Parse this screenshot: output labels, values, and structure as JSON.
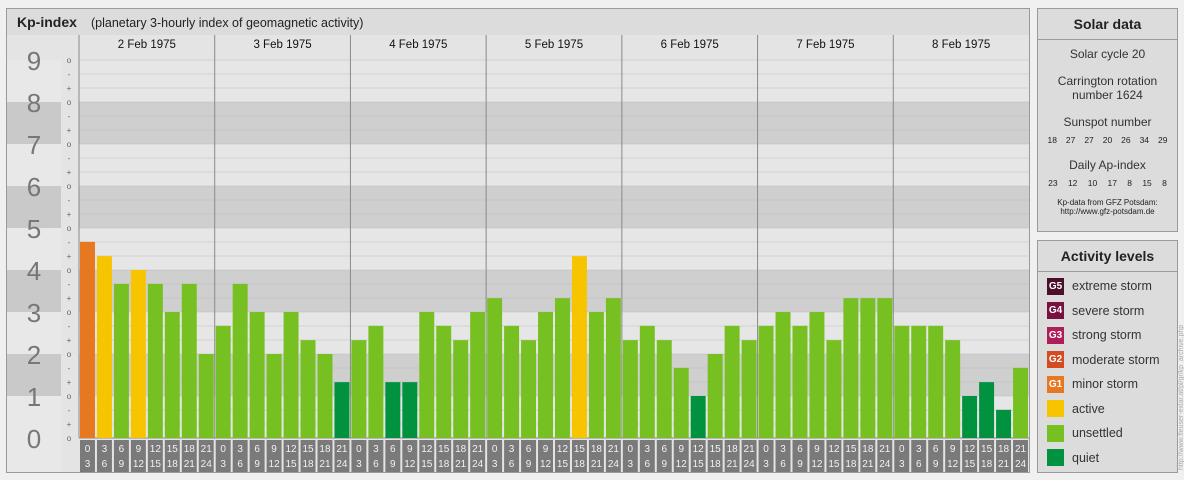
{
  "header": {
    "title": "Kp-index",
    "subtitle": "(planetary 3-hourly index of geomagnetic activity)"
  },
  "chart_data": {
    "type": "bar",
    "title": "Kp-index",
    "subtitle": "(planetary 3-hourly index of geomagnetic activity)",
    "ylim": [
      0,
      9
    ],
    "y_ticks": [
      "0",
      "1",
      "2",
      "3",
      "4",
      "5",
      "6",
      "7",
      "8",
      "9"
    ],
    "minor_marks": [
      "+",
      "o",
      "-"
    ],
    "days": [
      "2 Feb 1975",
      "3 Feb 1975",
      "4 Feb 1975",
      "5 Feb 1975",
      "6 Feb 1975",
      "7 Feb 1975",
      "8 Feb 1975"
    ],
    "interval_labels": [
      [
        "0",
        "3"
      ],
      [
        "3",
        "6"
      ],
      [
        "6",
        "9"
      ],
      [
        "9",
        "12"
      ],
      [
        "12",
        "15"
      ],
      [
        "15",
        "18"
      ],
      [
        "18",
        "21"
      ],
      [
        "21",
        "24"
      ]
    ],
    "values": [
      [
        4.67,
        4.33,
        3.67,
        4.0,
        3.67,
        3.0,
        3.67,
        2.0
      ],
      [
        2.67,
        3.67,
        3.0,
        2.0,
        3.0,
        2.33,
        2.0,
        1.33
      ],
      [
        2.33,
        2.67,
        1.33,
        1.33,
        3.0,
        2.67,
        2.33,
        3.0
      ],
      [
        3.33,
        2.67,
        2.33,
        3.0,
        3.33,
        4.33,
        3.0,
        3.33
      ],
      [
        2.33,
        2.67,
        2.33,
        1.67,
        1.0,
        2.0,
        2.67,
        2.33
      ],
      [
        2.67,
        3.0,
        2.67,
        3.0,
        2.33,
        3.33,
        3.33,
        3.33
      ],
      [
        2.67,
        2.67,
        2.67,
        2.33,
        1.0,
        1.33,
        0.67,
        1.67
      ]
    ],
    "colors": {
      "minor_storm": "#e87820",
      "active": "#f7c400",
      "unsettled": "#77c022",
      "quiet": "#00923f"
    }
  },
  "solar": {
    "title": "Solar data",
    "cycle": "Solar cycle 20",
    "carrington": "Carrington rotation number 1624",
    "sunspot_label": "Sunspot number",
    "sunspots": [
      "18",
      "27",
      "27",
      "20",
      "26",
      "34",
      "29"
    ],
    "ap_label": "Daily Ap-index",
    "ap": [
      "23",
      "12",
      "10",
      "17",
      "8",
      "15",
      "8"
    ],
    "note": "Kp-data from GFZ Potsdam: http://www.gfz-potsdam.de"
  },
  "activity": {
    "title": "Activity levels",
    "levels": [
      {
        "code": "G5",
        "label": "extreme storm",
        "color": "#4a0f2a"
      },
      {
        "code": "G4",
        "label": "severe storm",
        "color": "#7a1040"
      },
      {
        "code": "G3",
        "label": "strong storm",
        "color": "#b01e58"
      },
      {
        "code": "G2",
        "label": "moderate storm",
        "color": "#d64a20"
      },
      {
        "code": "G1",
        "label": "minor storm",
        "color": "#e87820"
      },
      {
        "code": "",
        "label": "active",
        "color": "#f7c400"
      },
      {
        "code": "",
        "label": "unsettled",
        "color": "#77c022"
      },
      {
        "code": "",
        "label": "quiet",
        "color": "#00923f"
      }
    ]
  },
  "credit": "http://www.fleuser-exlar.at/pl/gr/kp_archive.php"
}
